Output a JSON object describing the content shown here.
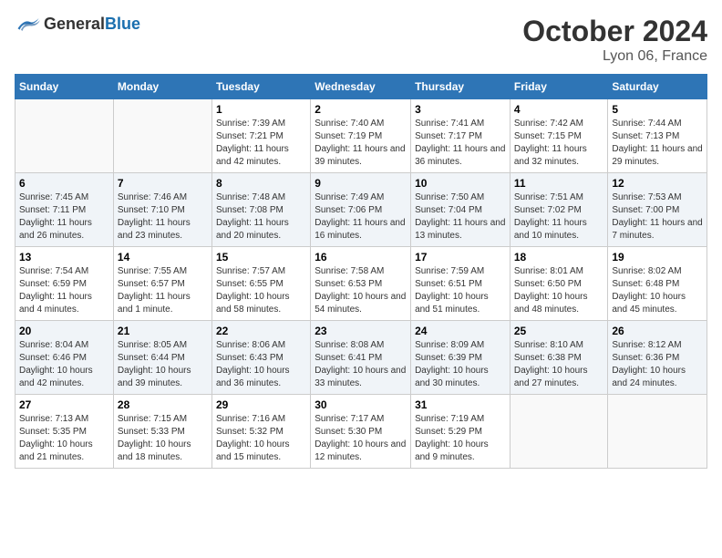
{
  "logo": {
    "general": "General",
    "blue": "Blue"
  },
  "header": {
    "month": "October 2024",
    "location": "Lyon 06, France"
  },
  "weekdays": [
    "Sunday",
    "Monday",
    "Tuesday",
    "Wednesday",
    "Thursday",
    "Friday",
    "Saturday"
  ],
  "weeks": [
    [
      {
        "day": "",
        "info": ""
      },
      {
        "day": "",
        "info": ""
      },
      {
        "day": "1",
        "sunrise": "Sunrise: 7:39 AM",
        "sunset": "Sunset: 7:21 PM",
        "daylight": "Daylight: 11 hours and 42 minutes."
      },
      {
        "day": "2",
        "sunrise": "Sunrise: 7:40 AM",
        "sunset": "Sunset: 7:19 PM",
        "daylight": "Daylight: 11 hours and 39 minutes."
      },
      {
        "day": "3",
        "sunrise": "Sunrise: 7:41 AM",
        "sunset": "Sunset: 7:17 PM",
        "daylight": "Daylight: 11 hours and 36 minutes."
      },
      {
        "day": "4",
        "sunrise": "Sunrise: 7:42 AM",
        "sunset": "Sunset: 7:15 PM",
        "daylight": "Daylight: 11 hours and 32 minutes."
      },
      {
        "day": "5",
        "sunrise": "Sunrise: 7:44 AM",
        "sunset": "Sunset: 7:13 PM",
        "daylight": "Daylight: 11 hours and 29 minutes."
      }
    ],
    [
      {
        "day": "6",
        "sunrise": "Sunrise: 7:45 AM",
        "sunset": "Sunset: 7:11 PM",
        "daylight": "Daylight: 11 hours and 26 minutes."
      },
      {
        "day": "7",
        "sunrise": "Sunrise: 7:46 AM",
        "sunset": "Sunset: 7:10 PM",
        "daylight": "Daylight: 11 hours and 23 minutes."
      },
      {
        "day": "8",
        "sunrise": "Sunrise: 7:48 AM",
        "sunset": "Sunset: 7:08 PM",
        "daylight": "Daylight: 11 hours and 20 minutes."
      },
      {
        "day": "9",
        "sunrise": "Sunrise: 7:49 AM",
        "sunset": "Sunset: 7:06 PM",
        "daylight": "Daylight: 11 hours and 16 minutes."
      },
      {
        "day": "10",
        "sunrise": "Sunrise: 7:50 AM",
        "sunset": "Sunset: 7:04 PM",
        "daylight": "Daylight: 11 hours and 13 minutes."
      },
      {
        "day": "11",
        "sunrise": "Sunrise: 7:51 AM",
        "sunset": "Sunset: 7:02 PM",
        "daylight": "Daylight: 11 hours and 10 minutes."
      },
      {
        "day": "12",
        "sunrise": "Sunrise: 7:53 AM",
        "sunset": "Sunset: 7:00 PM",
        "daylight": "Daylight: 11 hours and 7 minutes."
      }
    ],
    [
      {
        "day": "13",
        "sunrise": "Sunrise: 7:54 AM",
        "sunset": "Sunset: 6:59 PM",
        "daylight": "Daylight: 11 hours and 4 minutes."
      },
      {
        "day": "14",
        "sunrise": "Sunrise: 7:55 AM",
        "sunset": "Sunset: 6:57 PM",
        "daylight": "Daylight: 11 hours and 1 minute."
      },
      {
        "day": "15",
        "sunrise": "Sunrise: 7:57 AM",
        "sunset": "Sunset: 6:55 PM",
        "daylight": "Daylight: 10 hours and 58 minutes."
      },
      {
        "day": "16",
        "sunrise": "Sunrise: 7:58 AM",
        "sunset": "Sunset: 6:53 PM",
        "daylight": "Daylight: 10 hours and 54 minutes."
      },
      {
        "day": "17",
        "sunrise": "Sunrise: 7:59 AM",
        "sunset": "Sunset: 6:51 PM",
        "daylight": "Daylight: 10 hours and 51 minutes."
      },
      {
        "day": "18",
        "sunrise": "Sunrise: 8:01 AM",
        "sunset": "Sunset: 6:50 PM",
        "daylight": "Daylight: 10 hours and 48 minutes."
      },
      {
        "day": "19",
        "sunrise": "Sunrise: 8:02 AM",
        "sunset": "Sunset: 6:48 PM",
        "daylight": "Daylight: 10 hours and 45 minutes."
      }
    ],
    [
      {
        "day": "20",
        "sunrise": "Sunrise: 8:04 AM",
        "sunset": "Sunset: 6:46 PM",
        "daylight": "Daylight: 10 hours and 42 minutes."
      },
      {
        "day": "21",
        "sunrise": "Sunrise: 8:05 AM",
        "sunset": "Sunset: 6:44 PM",
        "daylight": "Daylight: 10 hours and 39 minutes."
      },
      {
        "day": "22",
        "sunrise": "Sunrise: 8:06 AM",
        "sunset": "Sunset: 6:43 PM",
        "daylight": "Daylight: 10 hours and 36 minutes."
      },
      {
        "day": "23",
        "sunrise": "Sunrise: 8:08 AM",
        "sunset": "Sunset: 6:41 PM",
        "daylight": "Daylight: 10 hours and 33 minutes."
      },
      {
        "day": "24",
        "sunrise": "Sunrise: 8:09 AM",
        "sunset": "Sunset: 6:39 PM",
        "daylight": "Daylight: 10 hours and 30 minutes."
      },
      {
        "day": "25",
        "sunrise": "Sunrise: 8:10 AM",
        "sunset": "Sunset: 6:38 PM",
        "daylight": "Daylight: 10 hours and 27 minutes."
      },
      {
        "day": "26",
        "sunrise": "Sunrise: 8:12 AM",
        "sunset": "Sunset: 6:36 PM",
        "daylight": "Daylight: 10 hours and 24 minutes."
      }
    ],
    [
      {
        "day": "27",
        "sunrise": "Sunrise: 7:13 AM",
        "sunset": "Sunset: 5:35 PM",
        "daylight": "Daylight: 10 hours and 21 minutes."
      },
      {
        "day": "28",
        "sunrise": "Sunrise: 7:15 AM",
        "sunset": "Sunset: 5:33 PM",
        "daylight": "Daylight: 10 hours and 18 minutes."
      },
      {
        "day": "29",
        "sunrise": "Sunrise: 7:16 AM",
        "sunset": "Sunset: 5:32 PM",
        "daylight": "Daylight: 10 hours and 15 minutes."
      },
      {
        "day": "30",
        "sunrise": "Sunrise: 7:17 AM",
        "sunset": "Sunset: 5:30 PM",
        "daylight": "Daylight: 10 hours and 12 minutes."
      },
      {
        "day": "31",
        "sunrise": "Sunrise: 7:19 AM",
        "sunset": "Sunset: 5:29 PM",
        "daylight": "Daylight: 10 hours and 9 minutes."
      },
      {
        "day": "",
        "info": ""
      },
      {
        "day": "",
        "info": ""
      }
    ]
  ]
}
